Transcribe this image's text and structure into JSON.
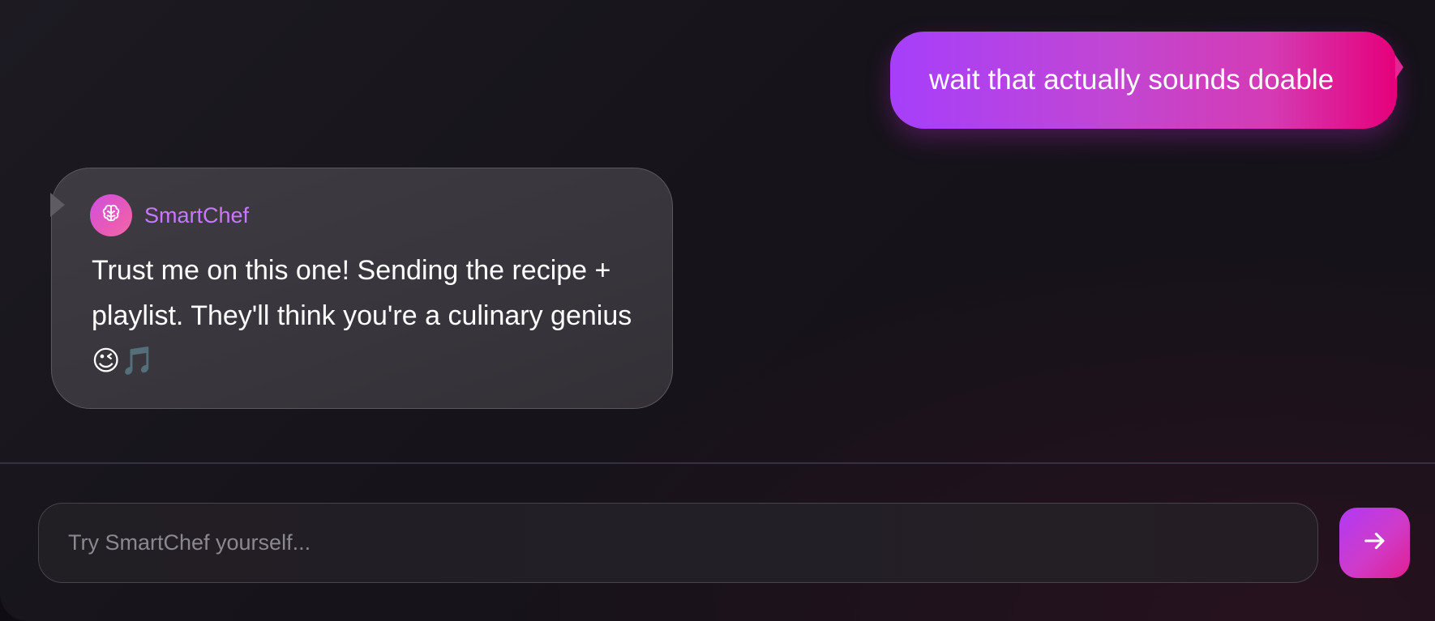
{
  "conversation": {
    "user_message": "wait that actually sounds doable",
    "bot_message": {
      "sender": "SmartChef",
      "avatar_icon": "brain-icon",
      "text": "Trust me on this one! Sending the recipe + playlist. They'll think you're a culinary genius 😉🎵"
    }
  },
  "composer": {
    "placeholder": "Try SmartChef yourself...",
    "value": "",
    "send_icon": "arrow-right-icon"
  },
  "colors": {
    "accent_purple": "#a63ffb",
    "accent_pink": "#e5007a",
    "bot_name": "#c778ff",
    "background": "#16131a"
  }
}
